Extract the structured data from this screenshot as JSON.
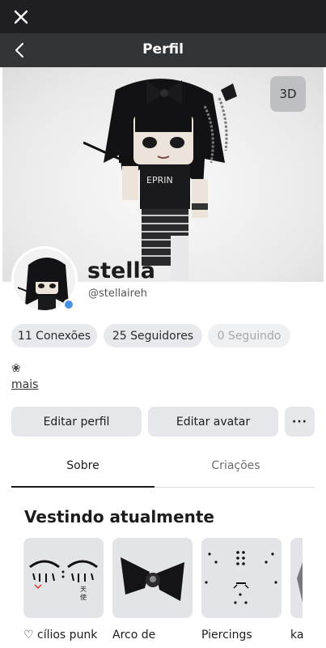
{
  "header": {
    "title": "Perfil"
  },
  "hero": {
    "view_3d_label": "3D"
  },
  "profile": {
    "display_name": "stella",
    "username": "@stellaireh",
    "status_color": "#4a90e2"
  },
  "stats": {
    "connections": "11 Conexões",
    "followers": "25 Seguidores",
    "following": "0 Seguindo"
  },
  "bio": {
    "icon": "❀",
    "more_label": "mais"
  },
  "actions": {
    "edit_profile": "Editar perfil",
    "edit_avatar": "Editar avatar",
    "more": "···"
  },
  "tabs": {
    "about": "Sobre",
    "creations": "Criações"
  },
  "wearing": {
    "title": "Vestindo atualmente",
    "items": [
      {
        "label": "♡ cílios punk"
      },
      {
        "label": "Arco de"
      },
      {
        "label": "Piercings"
      },
      {
        "label": "ka"
      }
    ]
  }
}
